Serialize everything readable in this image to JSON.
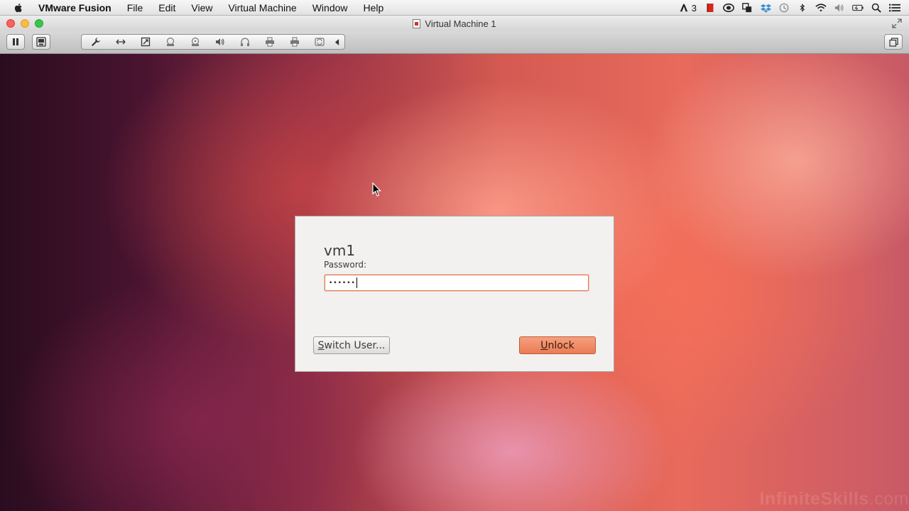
{
  "menubar": {
    "app_name": "VMware Fusion",
    "items": [
      "File",
      "Edit",
      "View",
      "Virtual Machine",
      "Window",
      "Help"
    ],
    "status_items": [
      {
        "icon": "adobe-icon",
        "text": "3"
      },
      {
        "icon": "red-app-icon"
      },
      {
        "icon": "cloud-sync-icon"
      },
      {
        "icon": "copy-icon"
      },
      {
        "icon": "dropbox-icon"
      },
      {
        "icon": "time-machine-icon"
      },
      {
        "icon": "bluetooth-icon"
      },
      {
        "icon": "wifi-icon"
      },
      {
        "icon": "volume-icon"
      },
      {
        "icon": "battery-icon"
      },
      {
        "icon": "spotlight-search-icon"
      },
      {
        "icon": "notification-list-icon"
      }
    ]
  },
  "window": {
    "title": "Virtual Machine 1"
  },
  "toolbar": {
    "tools": [
      "wrench-icon",
      "network-icon",
      "usb-icon",
      "disk-icon",
      "cd-icon",
      "sound-icon",
      "headphone-icon",
      "printer-icon",
      "camera-icon",
      "refresh-icon"
    ]
  },
  "lock_dialog": {
    "username": "vm1",
    "password_label": "Password:",
    "password_value": "••••••",
    "switch_user_label": "Switch User...",
    "switch_user_mnemonic": "S",
    "switch_user_rest": "witch User...",
    "unlock_label": "Unlock",
    "unlock_mnemonic": "U",
    "unlock_rest": "nlock"
  },
  "watermark": {
    "brand": "InfiniteSkills",
    "suffix": ".com"
  },
  "colors": {
    "dialog_bg": "#f2f1f0",
    "unlock_button": "#ea7c55",
    "focus_border": "#e57a4e"
  }
}
